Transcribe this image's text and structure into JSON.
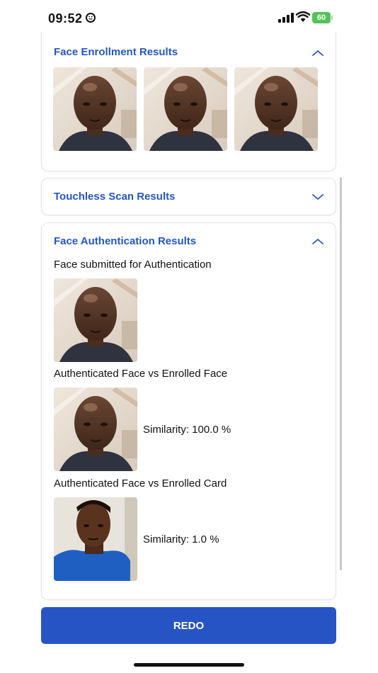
{
  "status_bar": {
    "time": "09:52",
    "battery": "60"
  },
  "enrollment": {
    "title": "Face Enrollment Results",
    "expanded": true,
    "photos": [
      "enrolled-face-1",
      "enrolled-face-2",
      "enrolled-face-3"
    ]
  },
  "touchless": {
    "title": "Touchless Scan Results",
    "expanded": false
  },
  "authentication": {
    "title": "Face Authentication Results",
    "expanded": true,
    "submitted_label": "Face submitted for Authentication",
    "face_vs_face_label": "Authenticated Face vs Enrolled Face",
    "face_similarity": "Similarity: 100.0 %",
    "face_vs_card_label": "Authenticated Face vs Enrolled Card",
    "card_similarity": "Similarity: 1.0 %"
  },
  "redo_label": "REDO",
  "colors": {
    "accent": "#2456c7",
    "button": "#2754c5",
    "battery": "#52c457"
  },
  "icons": [
    "smiley-icon",
    "signal-icon",
    "wifi-icon",
    "battery-icon",
    "chevron-up-icon",
    "chevron-down-icon"
  ]
}
